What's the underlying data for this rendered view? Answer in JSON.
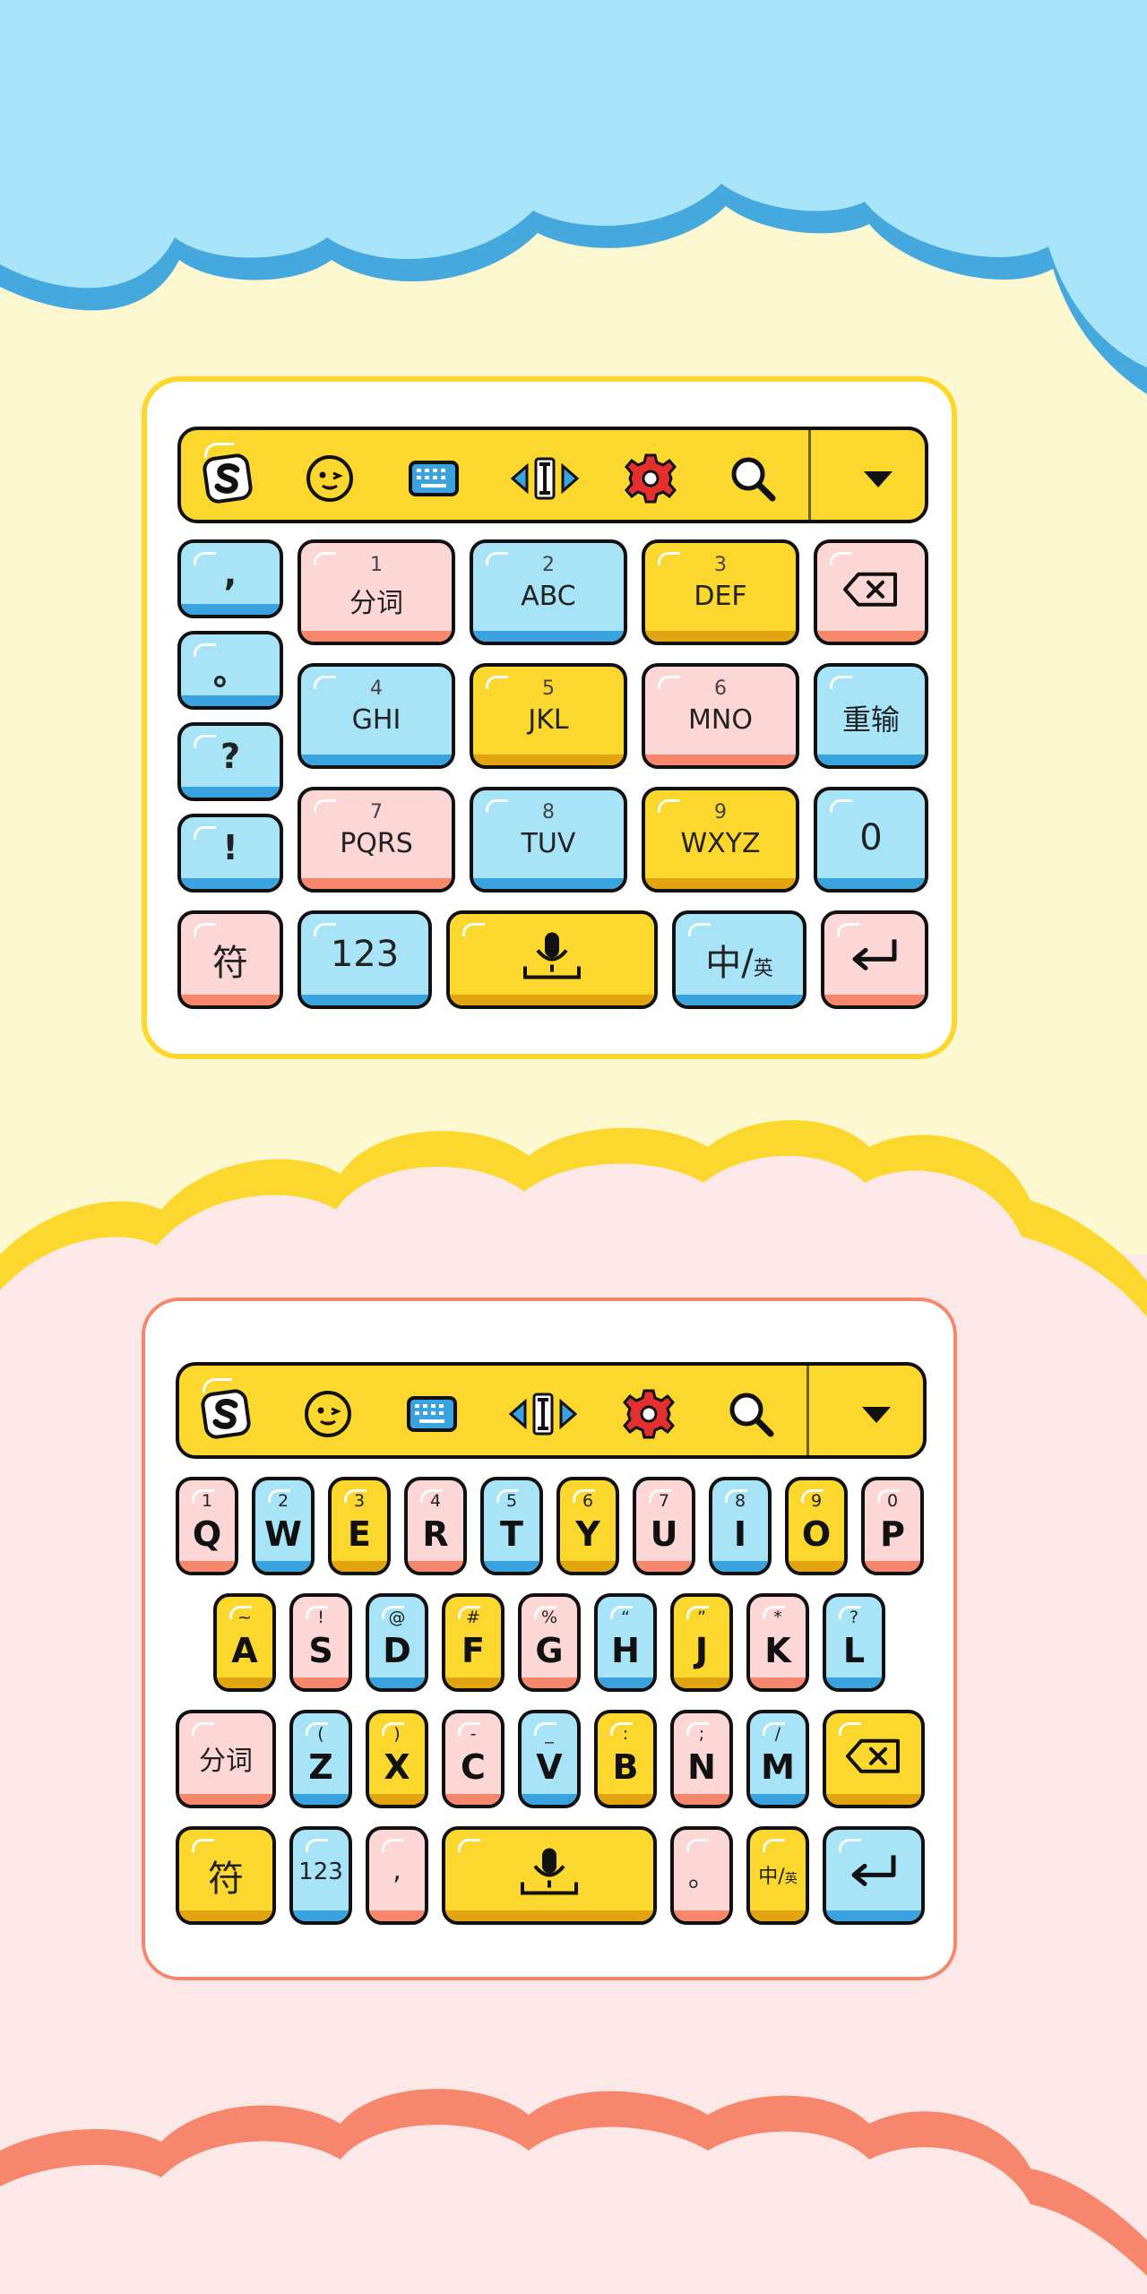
{
  "colors": {
    "sky": "#a9e5fa",
    "sky_edge": "#45a9de",
    "cream": "#fdf8d0",
    "sun": "#fcd72d",
    "blush": "#fde8e8",
    "coral": "#f7876c",
    "key_pink": "#fdd6d6",
    "key_blue": "#a8e4f7",
    "key_yellow": "#fcd72d",
    "outline": "#111111"
  },
  "toolbar": {
    "icons": [
      "sogou-logo-icon",
      "emoji-icon",
      "keyboard-icon",
      "cursor-move-icon",
      "gear-icon",
      "search-icon",
      "collapse-triangle-icon"
    ]
  },
  "t9_keyboard": {
    "punct_column": [
      ",",
      "。",
      "?",
      "!"
    ],
    "keys": [
      {
        "num": "1",
        "label": "分词"
      },
      {
        "num": "2",
        "label": "ABC"
      },
      {
        "num": "3",
        "label": "DEF"
      },
      {
        "num": "4",
        "label": "GHI"
      },
      {
        "num": "5",
        "label": "JKL"
      },
      {
        "num": "6",
        "label": "MNO"
      },
      {
        "num": "7",
        "label": "PQRS"
      },
      {
        "num": "8",
        "label": "TUV"
      },
      {
        "num": "9",
        "label": "WXYZ"
      }
    ],
    "backspace_icon": "backspace-icon",
    "reenter_label": "重输",
    "zero_label": "0",
    "symbol_label": "符",
    "num_label": "123",
    "mic_icon": "microphone-icon",
    "lang_main": "中/",
    "lang_sub": "英",
    "enter_icon": "enter-icon"
  },
  "qwerty_keyboard": {
    "row1": [
      {
        "sub": "1",
        "letter": "Q"
      },
      {
        "sub": "2",
        "letter": "W"
      },
      {
        "sub": "3",
        "letter": "E"
      },
      {
        "sub": "4",
        "letter": "R"
      },
      {
        "sub": "5",
        "letter": "T"
      },
      {
        "sub": "6",
        "letter": "Y"
      },
      {
        "sub": "7",
        "letter": "U"
      },
      {
        "sub": "8",
        "letter": "I"
      },
      {
        "sub": "9",
        "letter": "O"
      },
      {
        "sub": "0",
        "letter": "P"
      }
    ],
    "row2": [
      {
        "sub": "~",
        "letter": "A"
      },
      {
        "sub": "!",
        "letter": "S"
      },
      {
        "sub": "@",
        "letter": "D"
      },
      {
        "sub": "#",
        "letter": "F"
      },
      {
        "sub": "%",
        "letter": "G"
      },
      {
        "sub": "“",
        "letter": "H"
      },
      {
        "sub": "”",
        "letter": "J"
      },
      {
        "sub": "*",
        "letter": "K"
      },
      {
        "sub": "?",
        "letter": "L"
      }
    ],
    "row3": [
      {
        "sub": "(",
        "letter": "Z"
      },
      {
        "sub": ")",
        "letter": "X"
      },
      {
        "sub": "-",
        "letter": "C"
      },
      {
        "sub": "_",
        "letter": "V"
      },
      {
        "sub": ":",
        "letter": "B"
      },
      {
        "sub": ";",
        "letter": "N"
      },
      {
        "sub": "/",
        "letter": "M"
      }
    ],
    "segment_label": "分词",
    "symbol_label": "符",
    "num_label": "123",
    "comma_label": ",",
    "period_label": "。",
    "lang_main": "中/",
    "lang_sub": "英"
  }
}
